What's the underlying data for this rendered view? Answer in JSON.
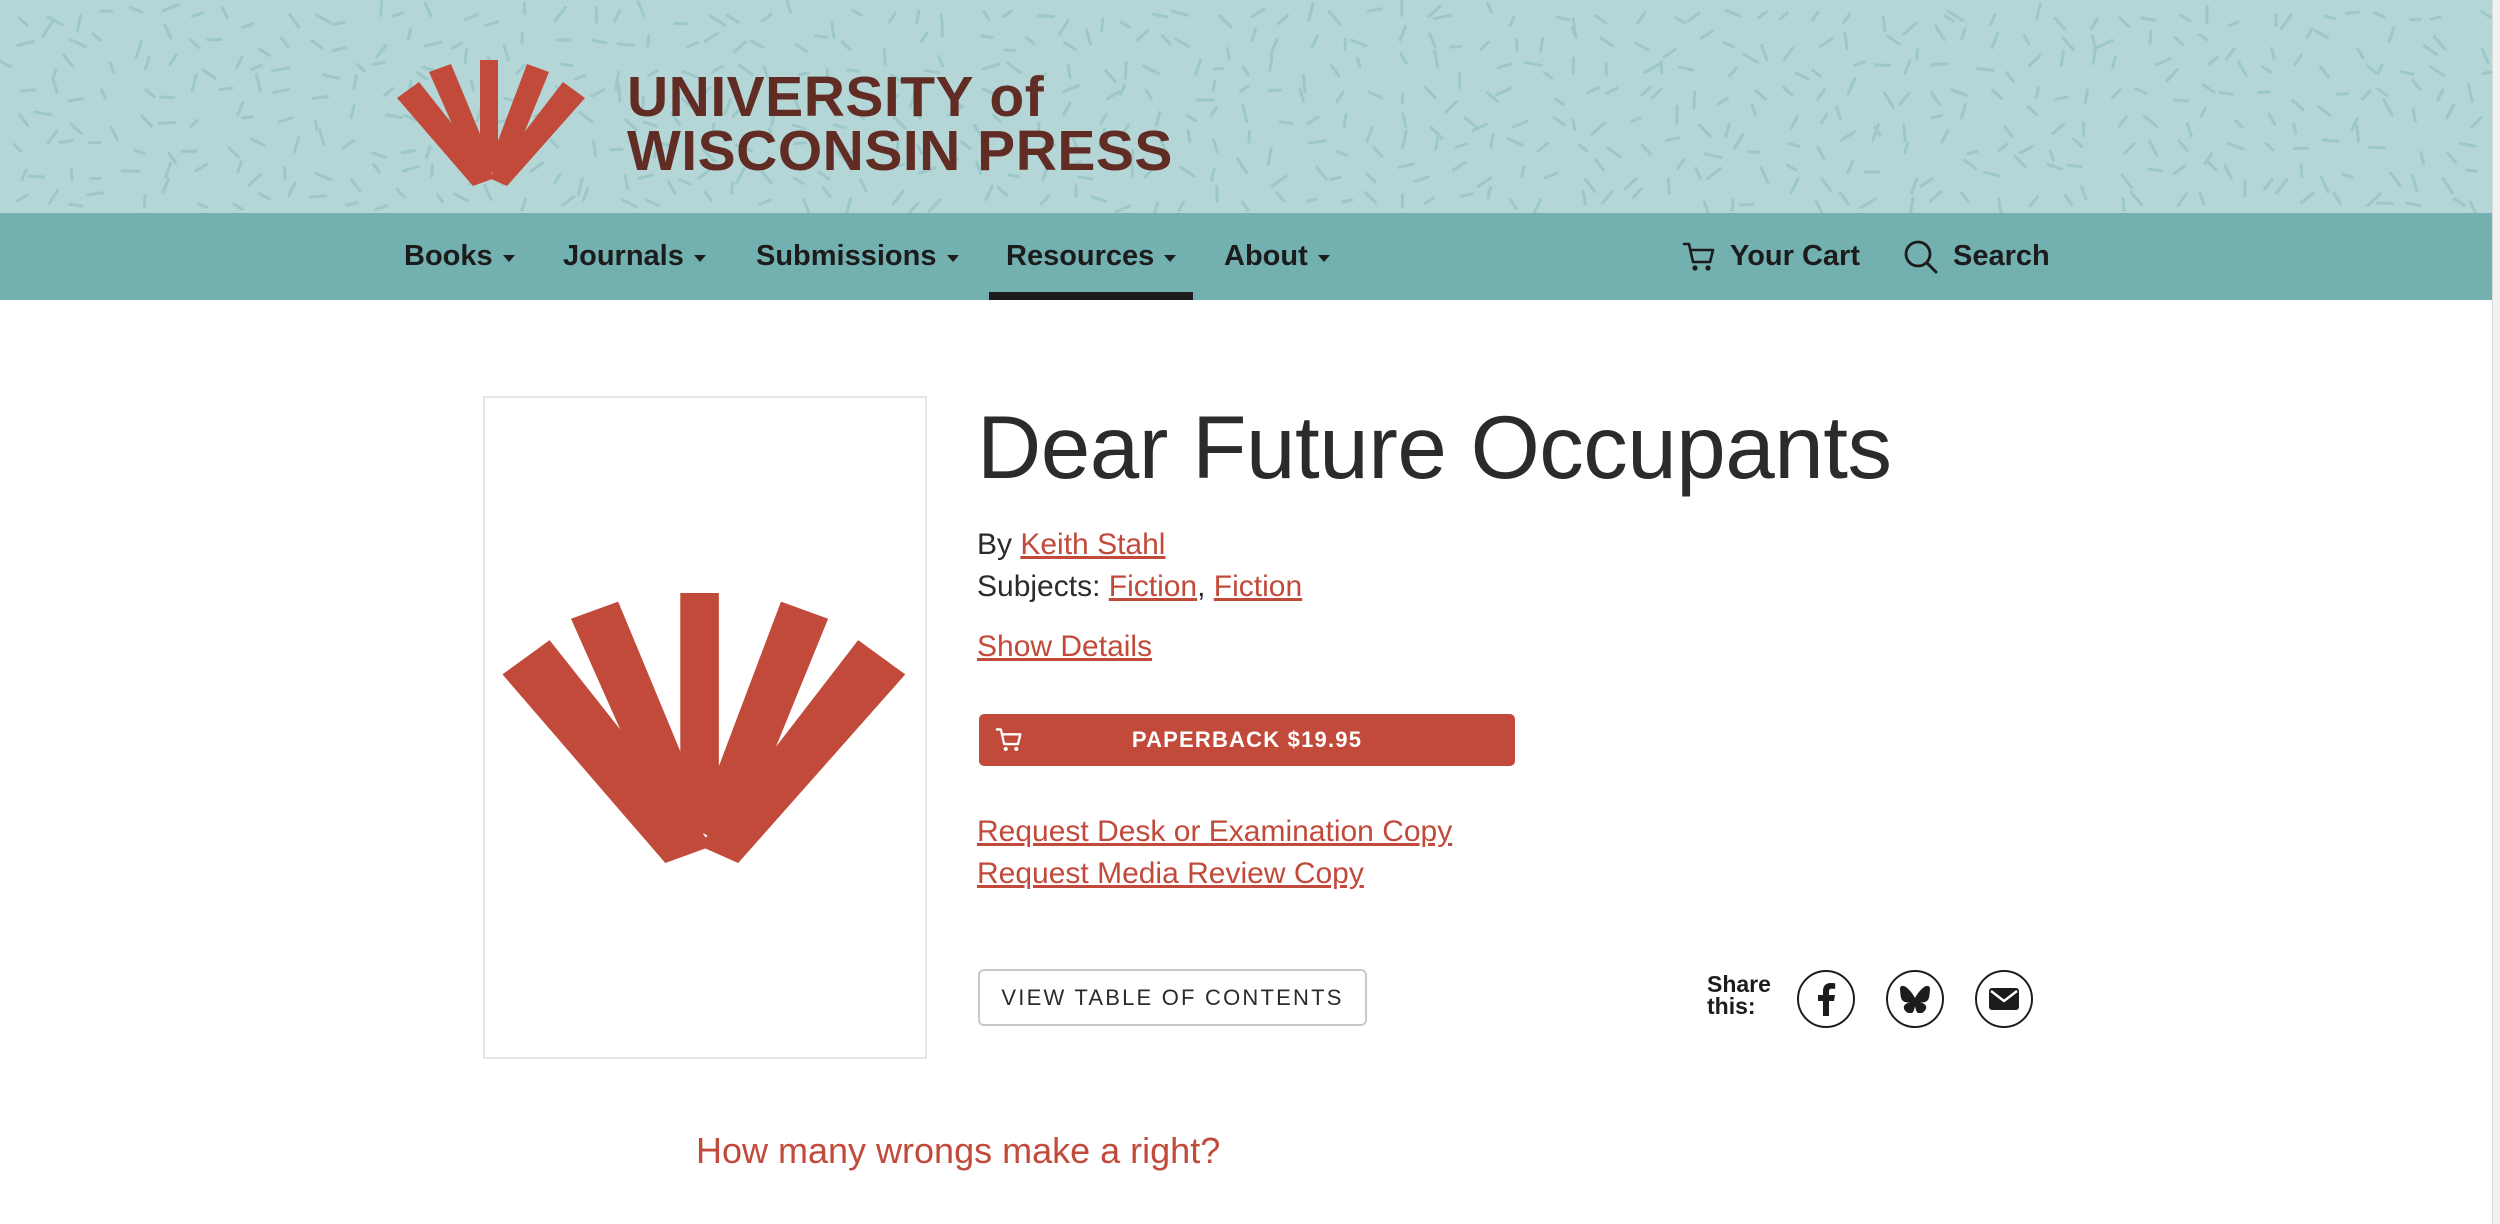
{
  "header": {
    "brand_line1": "UNIVERSITY",
    "brand_of": "of",
    "brand_line2": "WISCONSIN PRESS",
    "brand_color": "#612c24",
    "banner_color": "#b4d6d7",
    "logo_color": "#c14a3b"
  },
  "nav": {
    "bar_color": "#73b1b0",
    "items": [
      {
        "label": "Books",
        "icon": "caret-down-icon"
      },
      {
        "label": "Journals",
        "icon": "caret-down-icon"
      },
      {
        "label": "Submissions",
        "icon": "caret-down-icon"
      },
      {
        "label": "Resources",
        "icon": "caret-down-icon",
        "active": true
      },
      {
        "label": "About",
        "icon": "caret-down-icon"
      }
    ],
    "cart_label": "Your Cart",
    "cart_icon": "cart-icon",
    "search_label": "Search",
    "search_icon": "search-icon"
  },
  "book": {
    "title": "Dear Future Occupants",
    "by_prefix": "By",
    "author": "Keith Stahl",
    "subjects_prefix": "Subjects:",
    "subjects": [
      "Fiction",
      "Fiction"
    ],
    "subject_separator": ",",
    "show_details": "Show Details",
    "buy_label": "PAPERBACK $19.95",
    "request_desk": "Request Desk or Examination Copy",
    "request_media": "Request Media Review Copy",
    "toc_label": "VIEW TABLE OF CONTENTS",
    "tagline": "How many wrongs make a right?"
  },
  "share": {
    "label": "Share this:",
    "buttons": [
      "facebook-icon",
      "bluesky-icon",
      "email-icon"
    ]
  },
  "colors": {
    "accent": "#c14a3b",
    "text": "#2b2b2b"
  }
}
